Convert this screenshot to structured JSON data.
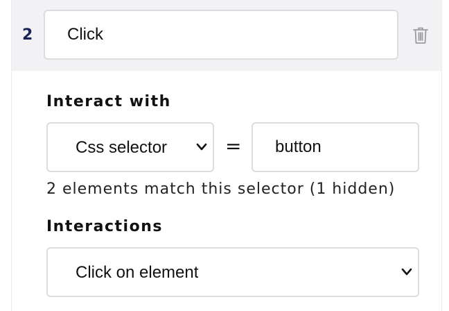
{
  "step": {
    "number": "2",
    "name_value": "Click",
    "delete_icon": "trash-icon"
  },
  "interact_with": {
    "label": "Interact with",
    "selector_type": "Css selector",
    "equals_sign": "=",
    "selector_value": "button",
    "match_info": "2 elements match this selector (1 hidden)"
  },
  "interactions": {
    "label": "Interactions",
    "selected": "Click on element"
  }
}
